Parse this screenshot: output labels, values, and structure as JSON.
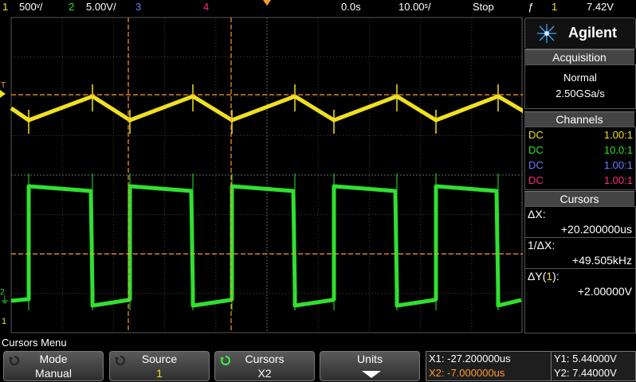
{
  "topbar": {
    "ch1_num": "1",
    "ch1_scale": "500ᵛ/",
    "ch2_num": "2",
    "ch2_scale": "5.00V/",
    "ch3_num": "3",
    "ch4_num": "4",
    "time_pos": "0.0s",
    "time_scale": "10.00ˢ/",
    "run_state": "Stop",
    "trigger_icon": "ƒ",
    "trigger_ch": "1",
    "trigger_level": "7.42V"
  },
  "screen": {
    "trigger_marker": "T",
    "ch1_marker": "1",
    "ch2_marker": "2",
    "ground_marker": "⏚"
  },
  "panel": {
    "brand": "Agilent",
    "acquisition_title": "Acquisition",
    "acq_mode": "Normal",
    "acq_rate": "2.50GSa/s",
    "channels_title": "Channels",
    "channels": [
      {
        "coupling": "DC",
        "probe": "1.00:1",
        "color": "#f0e020"
      },
      {
        "coupling": "DC",
        "probe": "10.0:1",
        "color": "#30e030"
      },
      {
        "coupling": "DC",
        "probe": "1.00:1",
        "color": "#6a7bff"
      },
      {
        "coupling": "DC",
        "probe": "1.00:1",
        "color": "#ff2a8a"
      }
    ],
    "cursors_title": "Cursors",
    "dx_label": "ΔX:",
    "dx_value": "+20.200000us",
    "inv_dx_label": "1/ΔX:",
    "inv_dx_value": "+49.505kHz",
    "dy_label_pre": "ΔY(",
    "dy_label_ch": "1",
    "dy_label_post": "):",
    "dy_value": "+2.00000V"
  },
  "menu": {
    "title": "Cursors Menu",
    "softkeys": [
      {
        "label": "Mode",
        "value": "Manual"
      },
      {
        "label": "Source",
        "value": "1"
      },
      {
        "label": "Cursors",
        "value": "X2"
      },
      {
        "label": "Units",
        "value": ""
      }
    ]
  },
  "readout": {
    "x1": "X1: -27.200000us",
    "x2": "X2: -7.000000us",
    "y1": "Y1: 5.44000V",
    "y2": "Y2: 7.44000V"
  },
  "colors": {
    "ch1": "#f0e020",
    "ch2": "#30e030",
    "ch3": "#6a7bff",
    "ch4": "#ff2a8a",
    "cursor": "#ff9a30",
    "grid": "#444444"
  }
}
